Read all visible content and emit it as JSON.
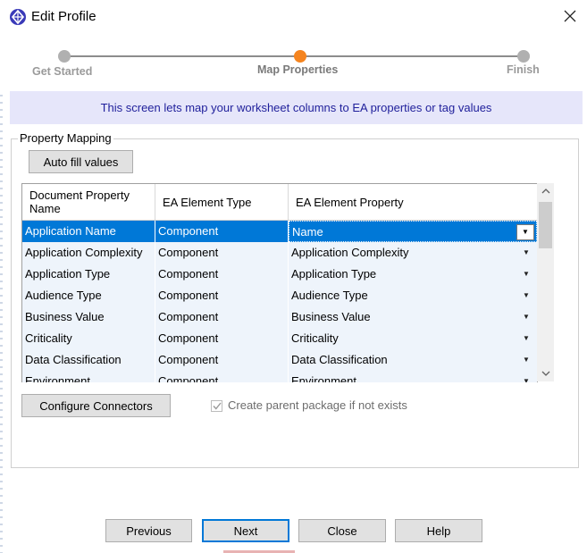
{
  "window": {
    "title": "Edit Profile"
  },
  "wizard": {
    "steps": [
      {
        "label": "Get Started",
        "state": "done"
      },
      {
        "label": "Map Properties",
        "state": "current"
      },
      {
        "label": "Finish",
        "state": "pending"
      }
    ],
    "colors": {
      "current": "#f5841f",
      "other": "#b0b0b0",
      "line": "#8c8c8c"
    }
  },
  "banner": {
    "text": "This screen lets map your worksheet columns to EA properties or tag values"
  },
  "group": {
    "title": "Property Mapping"
  },
  "buttons": {
    "auto_fill": "Auto fill values",
    "configure_connectors": "Configure Connectors",
    "previous": "Previous",
    "next": "Next",
    "close": "Close",
    "help": "Help"
  },
  "grid": {
    "columns": [
      "Document Property Name",
      "EA Element Type",
      "EA Element Property"
    ],
    "rows": [
      {
        "name": "Application Name",
        "type": "Component",
        "property": "Name",
        "selected": true
      },
      {
        "name": "Application Complexity",
        "type": "Component",
        "property": "Application Complexity",
        "selected": false
      },
      {
        "name": "Application Type",
        "type": "Component",
        "property": "Application Type",
        "selected": false
      },
      {
        "name": "Audience Type",
        "type": "Component",
        "property": "Audience Type",
        "selected": false
      },
      {
        "name": "Business Value",
        "type": "Component",
        "property": "Business Value",
        "selected": false
      },
      {
        "name": "Criticality",
        "type": "Component",
        "property": "Criticality",
        "selected": false
      },
      {
        "name": "Data Classification",
        "type": "Component",
        "property": "Data Classification",
        "selected": false
      },
      {
        "name": "Environment",
        "type": "Component",
        "property": "Environment",
        "selected": false
      }
    ]
  },
  "checkbox": {
    "label": "Create parent package if not exists",
    "checked": true,
    "enabled": false
  },
  "colors": {
    "selection": "#0078d7",
    "banner_bg": "#e6e6fa",
    "banner_text": "#1f1f9b",
    "row_bg": "#eef4fb"
  }
}
